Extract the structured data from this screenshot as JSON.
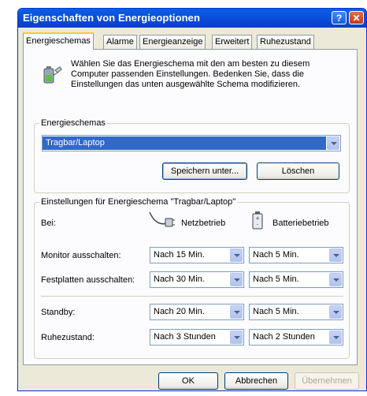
{
  "window": {
    "title": "Eigenschaften von Energieoptionen",
    "help_symbol": "?",
    "close_symbol": "✕"
  },
  "tabs": [
    "Energieschemas",
    "Alarme",
    "Energieanzeige",
    "Erweitert",
    "Ruhezustand"
  ],
  "active_tab": "Energieschemas",
  "intro_text": "Wählen Sie das Energieschema mit den am besten zu diesem Computer passenden Einstellungen. Bedenken Sie, dass die Einstellungen das unten ausgewählte Schema modifizieren.",
  "schemes_group": {
    "legend": "Energieschemas",
    "selected": "Tragbar/Laptop",
    "save_button": "Speichern unter...",
    "delete_button": "Löschen"
  },
  "settings_group": {
    "legend": "Einstellungen für Energieschema \"Tragbar/Laptop\"",
    "when_label": "Bei:",
    "ac_label": "Netzbetrieb",
    "battery_label": "Batteriebetrieb",
    "rows": [
      {
        "label": "Monitor ausschalten:",
        "ac": "Nach 15 Min.",
        "battery": "Nach 5 Min."
      },
      {
        "label": "Festplatten ausschalten:",
        "ac": "Nach 30 Min.",
        "battery": "Nach 5 Min."
      },
      {
        "label": "Standby:",
        "ac": "Nach 20 Min.",
        "battery": "Nach 5 Min."
      },
      {
        "label": "Ruhezustand:",
        "ac": "Nach 3 Stunden",
        "battery": "Nach 2 Stunden"
      }
    ]
  },
  "footer": {
    "ok": "OK",
    "cancel": "Abbrechen",
    "apply": "Übernehmen"
  },
  "icons": {
    "scheme": "battery-plug-icon",
    "ac": "power-plug-icon",
    "battery": "battery-icon"
  }
}
